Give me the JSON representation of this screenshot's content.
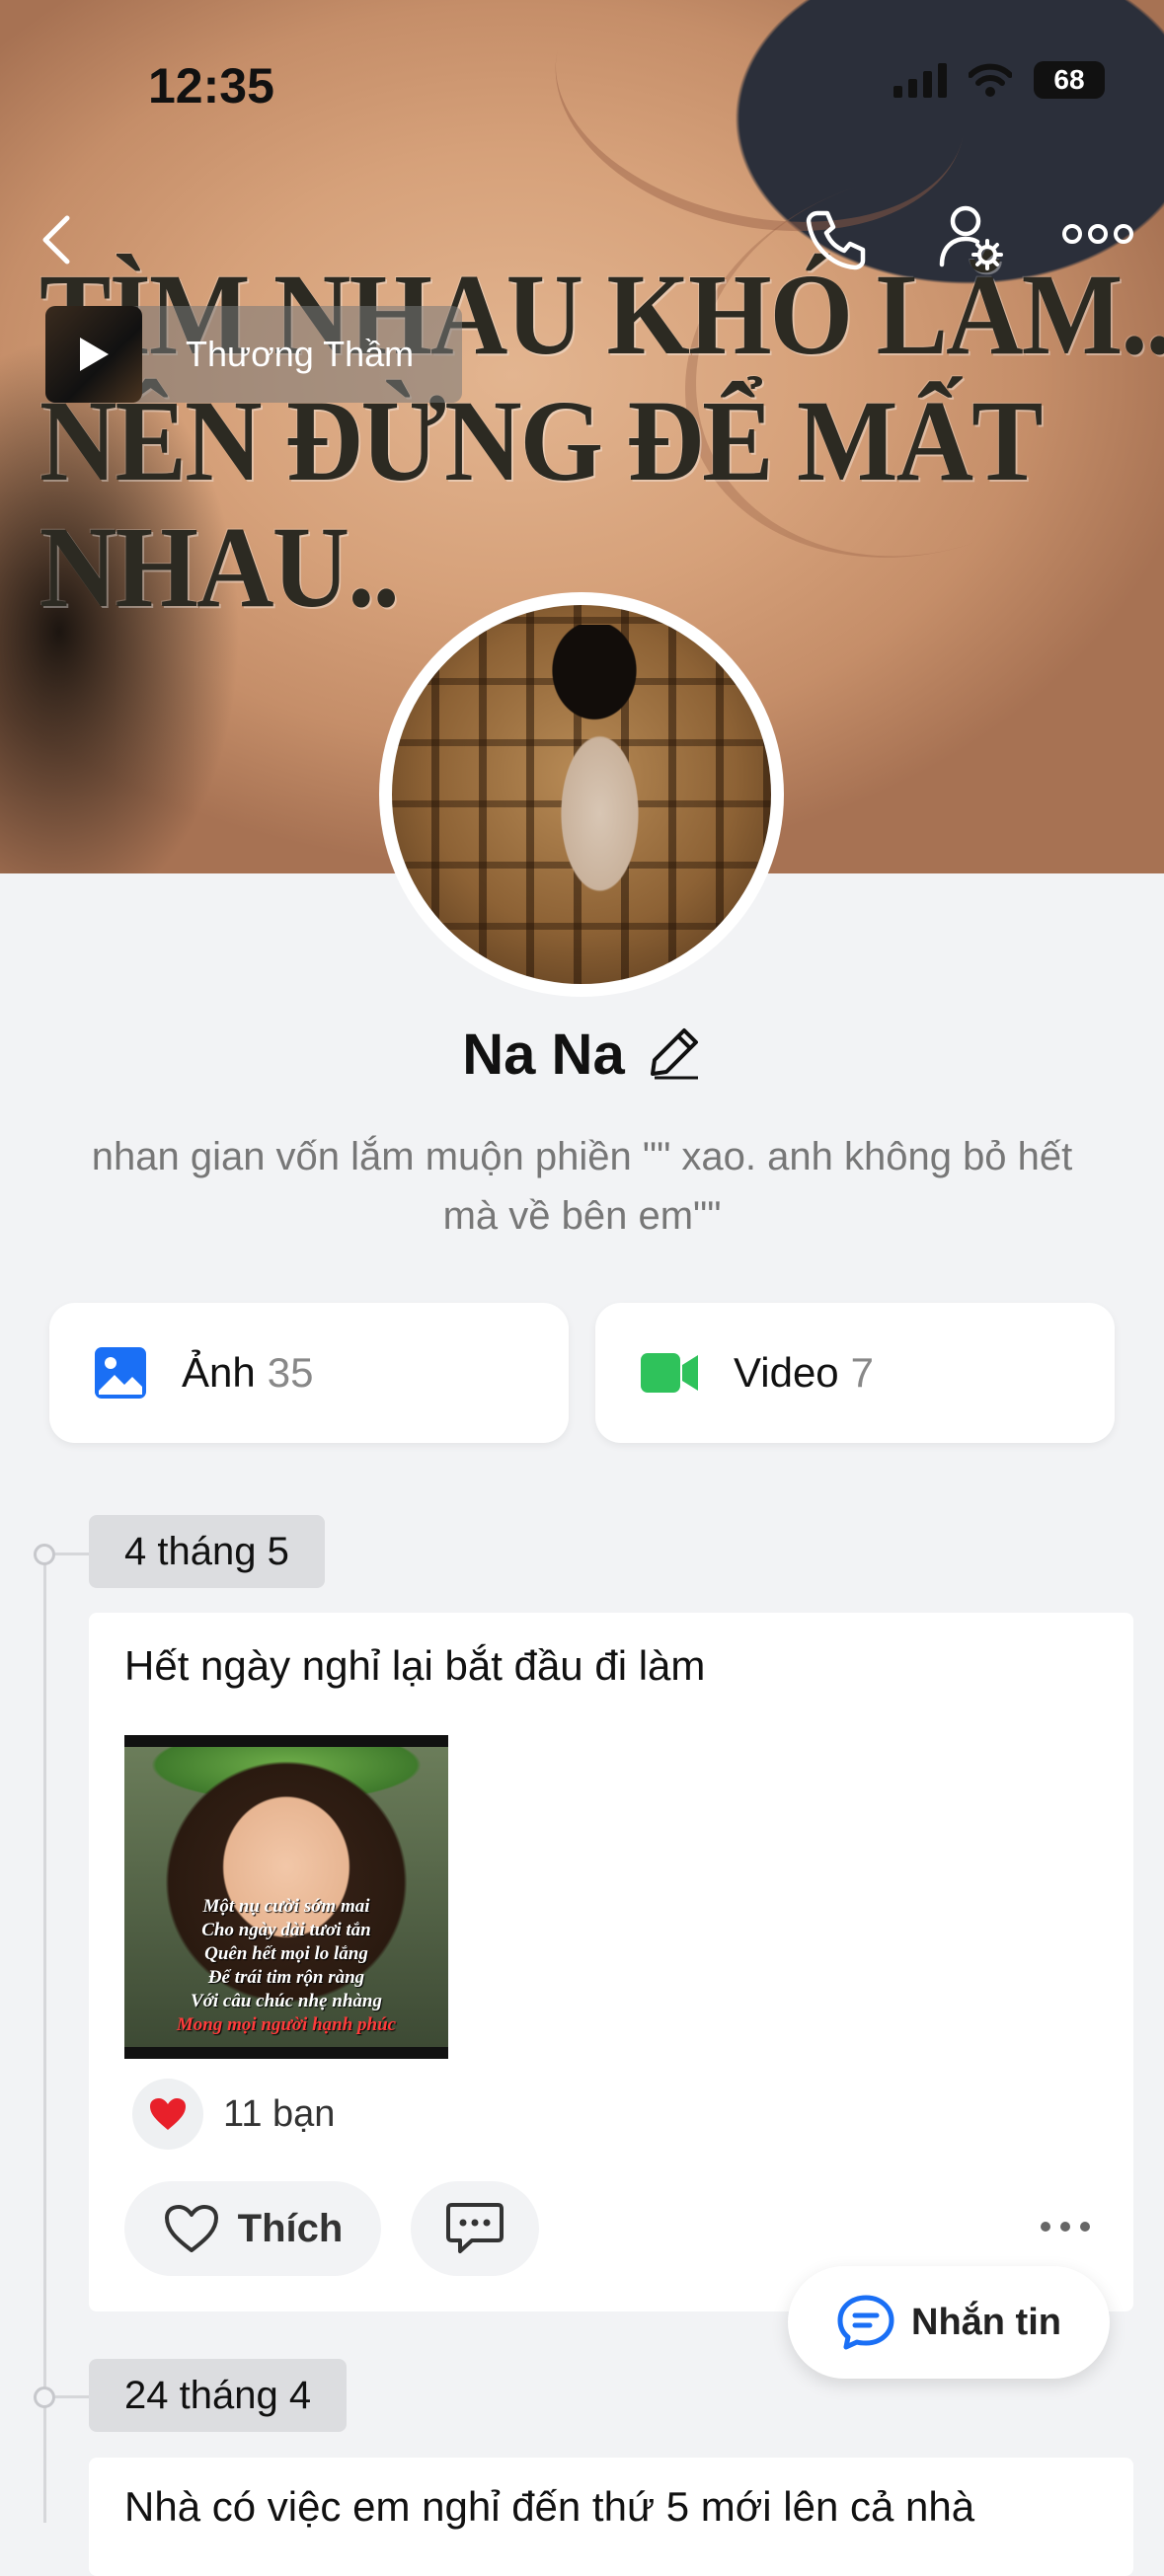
{
  "status_bar": {
    "time": "12:35",
    "battery": "68"
  },
  "cover": {
    "caption_lines": [
      "TÌM NHAU KHÓ LẮM...",
      "NÊN ĐỪNG ĐỂ MẤT",
      "NHAU.."
    ]
  },
  "header": {
    "back_icon": "chevron-left-icon",
    "call_icon": "phone-icon",
    "settings_icon": "user-settings-icon",
    "more_icon": "more-horizontal-icon"
  },
  "music": {
    "title": "Thương Thầm"
  },
  "profile": {
    "name": "Na Na",
    "bio": "nhan gian vốn lắm muộn phiền \"\" xao. anh không bỏ hết mà về bên em\"\""
  },
  "media": {
    "photos_label": "Ảnh",
    "photos_count": "35",
    "videos_label": "Video",
    "videos_count": "7",
    "photo_color": "#1a6ff5",
    "video_color": "#2fc25b"
  },
  "timeline": [
    {
      "date": "4 tháng 5",
      "post_text": "Hết ngày nghỉ lại bắt đầu đi làm",
      "image_poem": [
        "Một nụ cười sớm mai",
        "Cho ngày dài tươi tắn",
        "Quên hết mọi lo lắng",
        "Để trái tim rộn ràng",
        "Với câu chúc nhẹ nhàng",
        "Mong mọi người hạnh phúc"
      ],
      "reactions": "11 bạn",
      "like_label": "Thích"
    },
    {
      "date": "24 tháng 4",
      "post_text": "Nhà có việc em nghỉ đến thứ 5 mới lên cả nhà"
    }
  ],
  "fab": {
    "label": "Nhắn tin"
  }
}
